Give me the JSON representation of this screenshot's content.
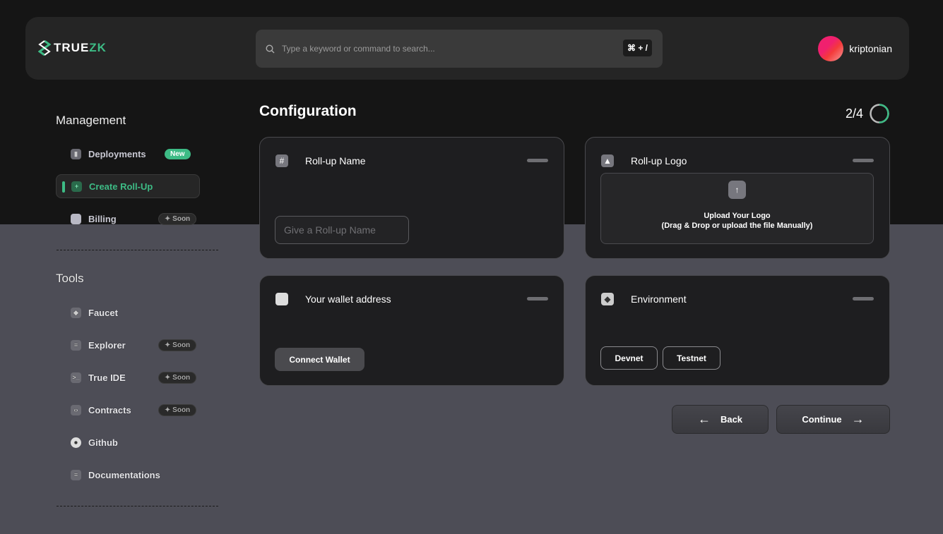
{
  "header": {
    "logo_text": "TRUE",
    "logo_accent": "ZK",
    "search_placeholder": "Type a keyword or command to search...",
    "shortcut": "⌘ + /",
    "username": "kriptonian"
  },
  "sidebar": {
    "management_title": "Management",
    "management_items": [
      {
        "label": "Deployments",
        "badge": "New",
        "icon": "rocket-icon"
      },
      {
        "label": "Create Roll-Up",
        "icon": "plus-square-icon",
        "active": true
      },
      {
        "label": "Billing",
        "badge": "Soon",
        "icon": "wallet-icon"
      }
    ],
    "tools_title": "Tools",
    "tools_items": [
      {
        "label": "Faucet",
        "icon": "cube-icon"
      },
      {
        "label": "Explorer",
        "badge": "Soon",
        "icon": "explorer-icon"
      },
      {
        "label": "True IDE",
        "badge": "Soon",
        "icon": "terminal-icon"
      },
      {
        "label": "Contracts",
        "badge": "Soon",
        "icon": "code-icon"
      },
      {
        "label": "Github",
        "icon": "github-icon"
      },
      {
        "label": "Documentations",
        "icon": "document-icon"
      }
    ]
  },
  "main": {
    "title": "Configuration",
    "step": "2/4",
    "progress": 0.5,
    "cards": {
      "name": {
        "title": "Roll-up Name",
        "placeholder": "Give a Roll-up Name"
      },
      "logo": {
        "title": "Roll-up Logo",
        "upload_title": "Upload Your Logo",
        "upload_hint": "(Drag & Drop or upload the file Manually)"
      },
      "wallet": {
        "title": "Your wallet address",
        "button": "Connect Wallet"
      },
      "env": {
        "title": "Environment",
        "options": [
          "Devnet",
          "Testnet"
        ]
      }
    },
    "back": "Back",
    "continue": "Continue"
  },
  "colors": {
    "accent": "#3dbb85",
    "panel": "#1e1e20"
  }
}
